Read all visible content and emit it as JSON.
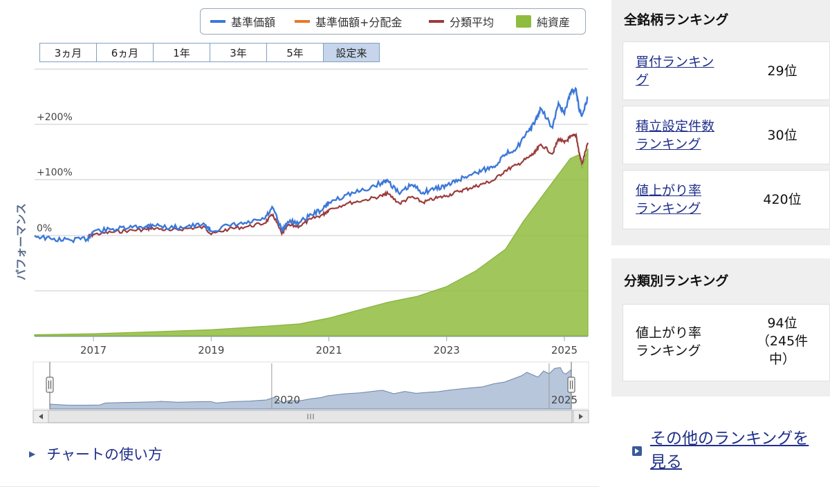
{
  "legend": {
    "items": [
      {
        "label": "基準価額",
        "color": "#3c78d8",
        "kind": "line"
      },
      {
        "label": "基準価額+分配金",
        "color": "#e8782a",
        "kind": "line"
      },
      {
        "label": "分類平均",
        "color": "#9b3b3b",
        "kind": "line"
      },
      {
        "label": "純資産",
        "color": "#8fbc3f",
        "kind": "area"
      }
    ]
  },
  "period_tabs": [
    {
      "label": "3ヵ月",
      "active": false
    },
    {
      "label": "6ヵ月",
      "active": false
    },
    {
      "label": "1年",
      "active": false
    },
    {
      "label": "3年",
      "active": false
    },
    {
      "label": "5年",
      "active": false
    },
    {
      "label": "設定来",
      "active": true
    }
  ],
  "chart_data": {
    "type": "line",
    "ylabel": "パフォーマンス",
    "yticks": [
      "+200%",
      "+100%",
      "0%"
    ],
    "x_ticks": [
      "2017",
      "2019",
      "2021",
      "2023",
      "2025"
    ],
    "xlim": [
      2016.0,
      2025.4
    ],
    "ylim": [
      -20,
      300
    ],
    "series": [
      {
        "name": "基準価額",
        "color": "#3c78d8",
        "x": [
          2016.0,
          2016.3,
          2016.6,
          2016.9,
          2017.0,
          2017.3,
          2017.6,
          2017.9,
          2018.0,
          2018.3,
          2018.6,
          2018.9,
          2019.0,
          2019.3,
          2019.6,
          2019.9,
          2020.05,
          2020.2,
          2020.3,
          2020.5,
          2020.7,
          2020.9,
          2021.0,
          2021.3,
          2021.6,
          2021.9,
          2022.0,
          2022.2,
          2022.4,
          2022.6,
          2022.8,
          2023.0,
          2023.2,
          2023.4,
          2023.6,
          2023.8,
          2024.0,
          2024.2,
          2024.4,
          2024.5,
          2024.6,
          2024.8,
          2024.9,
          2025.0,
          2025.1,
          2025.2,
          2025.25,
          2025.3,
          2025.4
        ],
        "y": [
          0,
          -7,
          -8,
          -6,
          8,
          11,
          14,
          17,
          20,
          14,
          17,
          19,
          8,
          18,
          22,
          30,
          50,
          8,
          25,
          24,
          38,
          48,
          60,
          74,
          82,
          96,
          100,
          75,
          92,
          78,
          85,
          90,
          101,
          110,
          118,
          125,
          147,
          160,
          190,
          205,
          230,
          195,
          240,
          220,
          258,
          265,
          228,
          218,
          250
        ]
      },
      {
        "name": "分類平均",
        "color": "#9b3b3b",
        "x": [
          2016.9,
          2017.0,
          2017.3,
          2017.6,
          2017.9,
          2018.0,
          2018.3,
          2018.6,
          2018.9,
          2019.0,
          2019.3,
          2019.6,
          2019.9,
          2020.05,
          2020.2,
          2020.3,
          2020.5,
          2020.7,
          2020.9,
          2021.0,
          2021.3,
          2021.6,
          2021.9,
          2022.0,
          2022.2,
          2022.4,
          2022.6,
          2022.8,
          2023.0,
          2023.2,
          2023.4,
          2023.6,
          2023.8,
          2024.0,
          2024.2,
          2024.4,
          2024.5,
          2024.6,
          2024.8,
          2024.9,
          2025.0,
          2025.1,
          2025.2,
          2025.25,
          2025.3,
          2025.4
        ],
        "y": [
          -2,
          2,
          6,
          9,
          11,
          14,
          9,
          13,
          15,
          2,
          12,
          16,
          22,
          38,
          3,
          18,
          17,
          30,
          38,
          47,
          58,
          64,
          72,
          76,
          58,
          70,
          60,
          67,
          72,
          80,
          86,
          93,
          100,
          118,
          128,
          142,
          150,
          165,
          148,
          175,
          168,
          178,
          182,
          150,
          130,
          168
        ]
      }
    ],
    "area": {
      "name": "純資産",
      "color": "#8fbc3f",
      "x": [
        2016.0,
        2017.0,
        2018.0,
        2019.0,
        2019.5,
        2020.0,
        2020.5,
        2021.0,
        2021.5,
        2022.0,
        2022.5,
        2023.0,
        2023.5,
        2024.0,
        2024.3,
        2024.6,
        2024.9,
        2025.1,
        2025.25,
        2025.3,
        2025.4
      ],
      "y": [
        0.5,
        1,
        2,
        3,
        4,
        5,
        6,
        9,
        13,
        17,
        20,
        25,
        33,
        44,
        58,
        70,
        82,
        90,
        92,
        85,
        95
      ]
    },
    "navigator": {
      "x_ticks": [
        "2020",
        "2025"
      ]
    }
  },
  "howto_link": "チャートの使い方",
  "all_ranking": {
    "title": "全銘柄ランキング",
    "rows": [
      {
        "label_line1": "買付ランキン",
        "label_line2": "グ",
        "rank": "29位"
      },
      {
        "label_line1": "積立設定件数",
        "label_line2": "ランキング",
        "rank": "30位"
      },
      {
        "label_line1": "値上がり率",
        "label_line2": "ランキング",
        "rank": "420位"
      }
    ]
  },
  "class_ranking": {
    "title": "分類別ランキング",
    "row": {
      "label_line1": "値上がり率",
      "label_line2": "ランキング",
      "rank_line1": "94位",
      "rank_line2": "（245件",
      "rank_line3": "中）"
    }
  },
  "more_link": {
    "line1": "その他のランキングを",
    "line2": "見る"
  }
}
